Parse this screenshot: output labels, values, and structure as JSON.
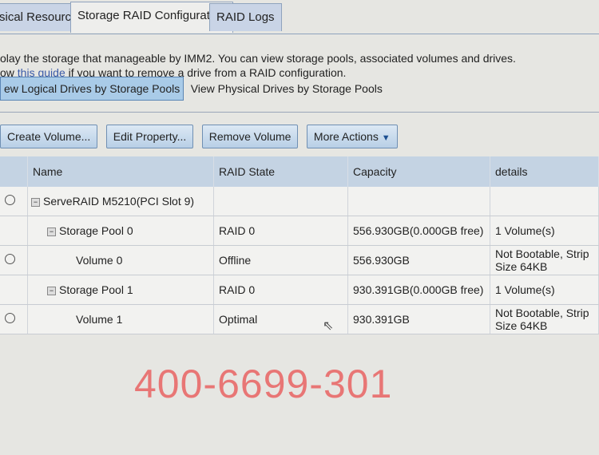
{
  "tabs": [
    {
      "label": "sical Resource"
    },
    {
      "label": "Storage RAID Configuration",
      "active": true
    },
    {
      "label": "RAID Logs"
    }
  ],
  "description": {
    "line1": "olay the storage that manageable by IMM2. You can view storage pools, associated volumes and drives.",
    "line2_pre": "ow ",
    "link": "this guide",
    "line2_post": " if you want to remove a drive from a RAID configuration."
  },
  "views": [
    {
      "label": "ew Logical Drives by Storage Pools",
      "selected": true
    },
    {
      "label": "View Physical Drives by Storage Pools"
    }
  ],
  "actions": {
    "create": "Create Volume...",
    "edit": "Edit Property...",
    "remove": "Remove Volume",
    "more": "More Actions",
    "more_icon": "▼"
  },
  "table": {
    "headers": [
      "Name",
      "RAID State",
      "Capacity",
      "details"
    ],
    "rows": [
      {
        "radio": true,
        "toggle": "−",
        "indent": 0,
        "name": "ServeRAID M5210(PCI Slot 9)",
        "state": "",
        "capacity": "",
        "details": ""
      },
      {
        "radio": false,
        "toggle": "−",
        "indent": 1,
        "name": "Storage Pool 0",
        "state": "RAID 0",
        "capacity": "556.930GB(0.000GB free)",
        "details": "1 Volume(s)"
      },
      {
        "radio": true,
        "toggle": "",
        "indent": 2,
        "name": "Volume 0",
        "state": "Offline",
        "capacity": "556.930GB",
        "details": "Not Bootable, Strip Size 64KB"
      },
      {
        "radio": false,
        "toggle": "−",
        "indent": 1,
        "name": "Storage Pool 1",
        "state": "RAID 0",
        "capacity": "930.391GB(0.000GB free)",
        "details": "1 Volume(s)"
      },
      {
        "radio": true,
        "toggle": "",
        "indent": 2,
        "name": "Volume 1",
        "state": "Optimal",
        "capacity": "930.391GB",
        "details": "Not Bootable, Strip Size 64KB"
      }
    ]
  },
  "watermark": "400-6699-301",
  "colors": {
    "accent": "#a9cbe8",
    "watermark": "#e96a6a",
    "link": "#3a5aa8"
  }
}
